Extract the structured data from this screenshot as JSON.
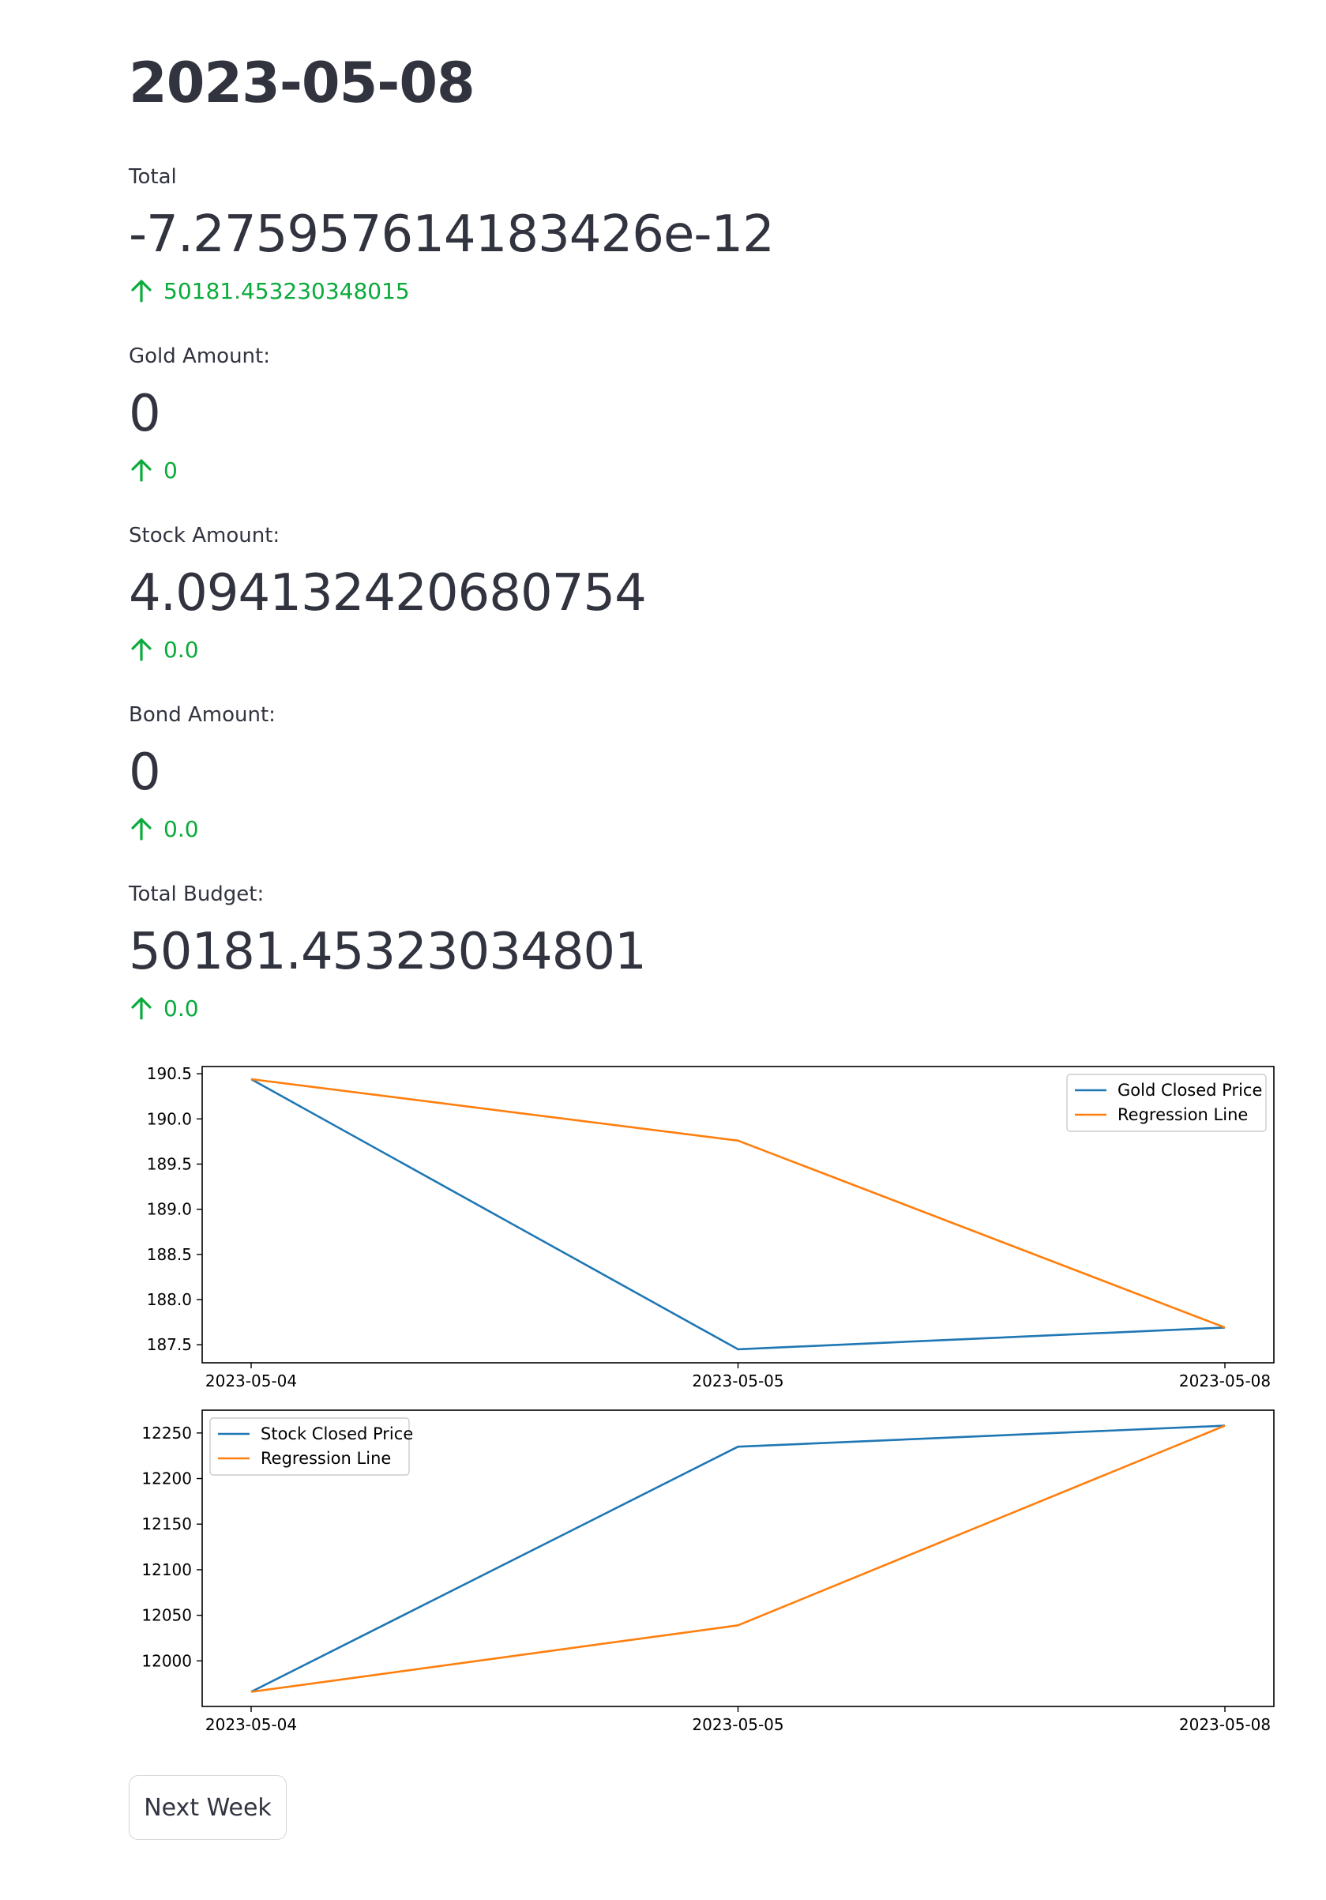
{
  "page": {
    "title": "2023-05-08"
  },
  "metrics": [
    {
      "label": "Total",
      "value": "-7.275957614183426e-12",
      "delta": "50181.453230348015"
    },
    {
      "label": "Gold Amount:",
      "value": "0",
      "delta": "0"
    },
    {
      "label": "Stock Amount:",
      "value": "4.094132420680754",
      "delta": "0.0"
    },
    {
      "label": "Bond Amount:",
      "value": "0",
      "delta": "0.0"
    },
    {
      "label": "Total Budget:",
      "value": "50181.45323034801",
      "delta": "0.0"
    }
  ],
  "colors": {
    "delta_positive": "#09ab3b",
    "series_blue": "#1f77b4",
    "series_orange": "#ff7f0e"
  },
  "icons": {
    "delta": "arrow-up-icon"
  },
  "chart_data": [
    {
      "type": "line",
      "x": [
        "2023-05-04",
        "2023-05-05",
        "2023-05-08"
      ],
      "series": [
        {
          "name": "Gold Closed Price",
          "values": [
            190.44,
            187.45,
            187.69
          ]
        },
        {
          "name": "Regression Line",
          "values": [
            190.44,
            189.76,
            187.69
          ]
        }
      ],
      "yticks": [
        "187.5",
        "188.0",
        "188.5",
        "189.0",
        "189.5",
        "190.0",
        "190.5"
      ],
      "ylim": [
        187.3,
        190.58
      ],
      "legend": "top-right",
      "grid": false
    },
    {
      "type": "line",
      "x": [
        "2023-05-04",
        "2023-05-05",
        "2023-05-08"
      ],
      "series": [
        {
          "name": "Stock Closed Price",
          "values": [
            11966,
            12235,
            12258
          ]
        },
        {
          "name": "Regression Line",
          "values": [
            11966,
            12039,
            12258
          ]
        }
      ],
      "yticks": [
        "12000",
        "12050",
        "12100",
        "12150",
        "12200",
        "12250"
      ],
      "ylim": [
        11950,
        12275
      ],
      "legend": "top-left",
      "grid": false
    }
  ],
  "buttons": {
    "next_week": "Next Week"
  }
}
